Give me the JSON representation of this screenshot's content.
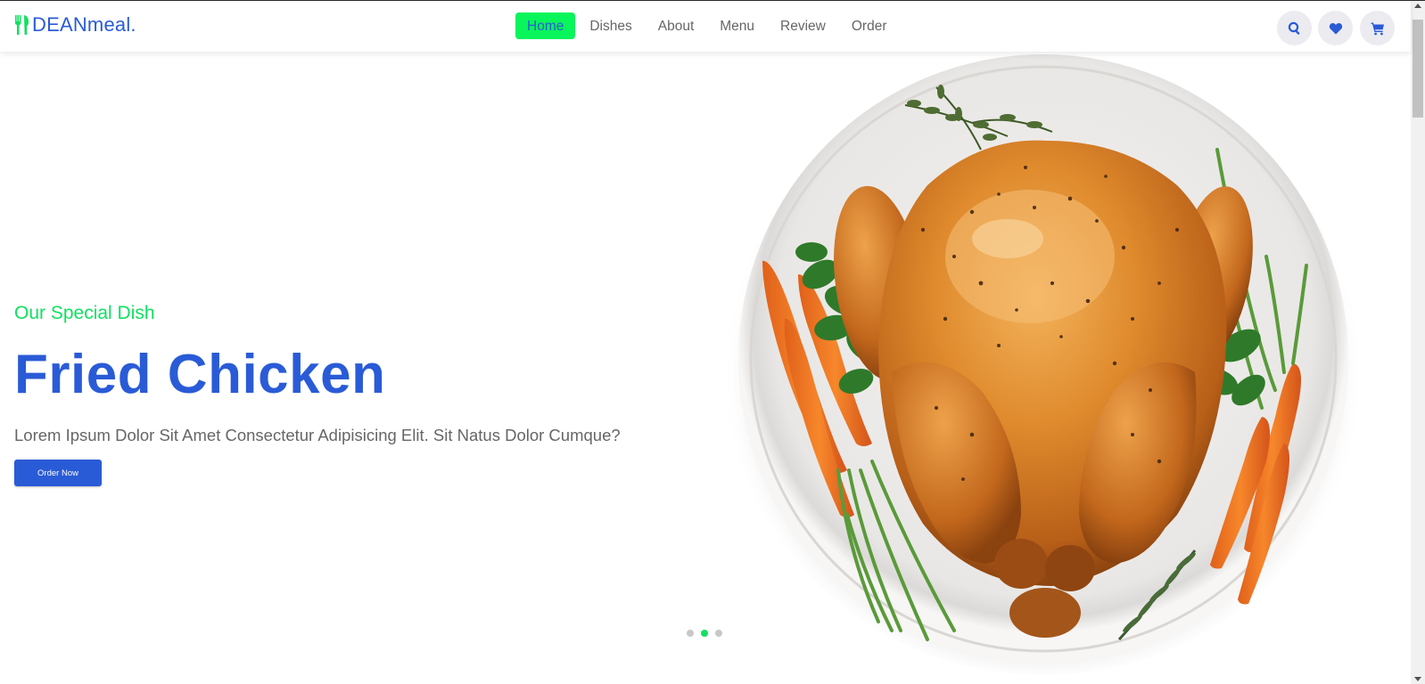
{
  "header": {
    "logo_text": "DEANmeal.",
    "nav_items": [
      "Home",
      "Dishes",
      "About",
      "Menu",
      "Review",
      "Order"
    ],
    "active_nav": "Home",
    "icons": [
      "search-icon",
      "heart-icon",
      "cart-icon"
    ]
  },
  "hero": {
    "subtitle": "Our Special Dish",
    "title": "Fried Chicken",
    "description": "Lorem Ipsum Dolor Sit Amet Consectetur Adipisicing Elit. Sit Natus Dolor Cumque?",
    "button_label": "Order Now",
    "slides_total": 3,
    "active_slide": 2
  },
  "colors": {
    "brand_blue": "#2a5bd7",
    "accent_green": "#08f55b",
    "text_gray": "#666666"
  }
}
